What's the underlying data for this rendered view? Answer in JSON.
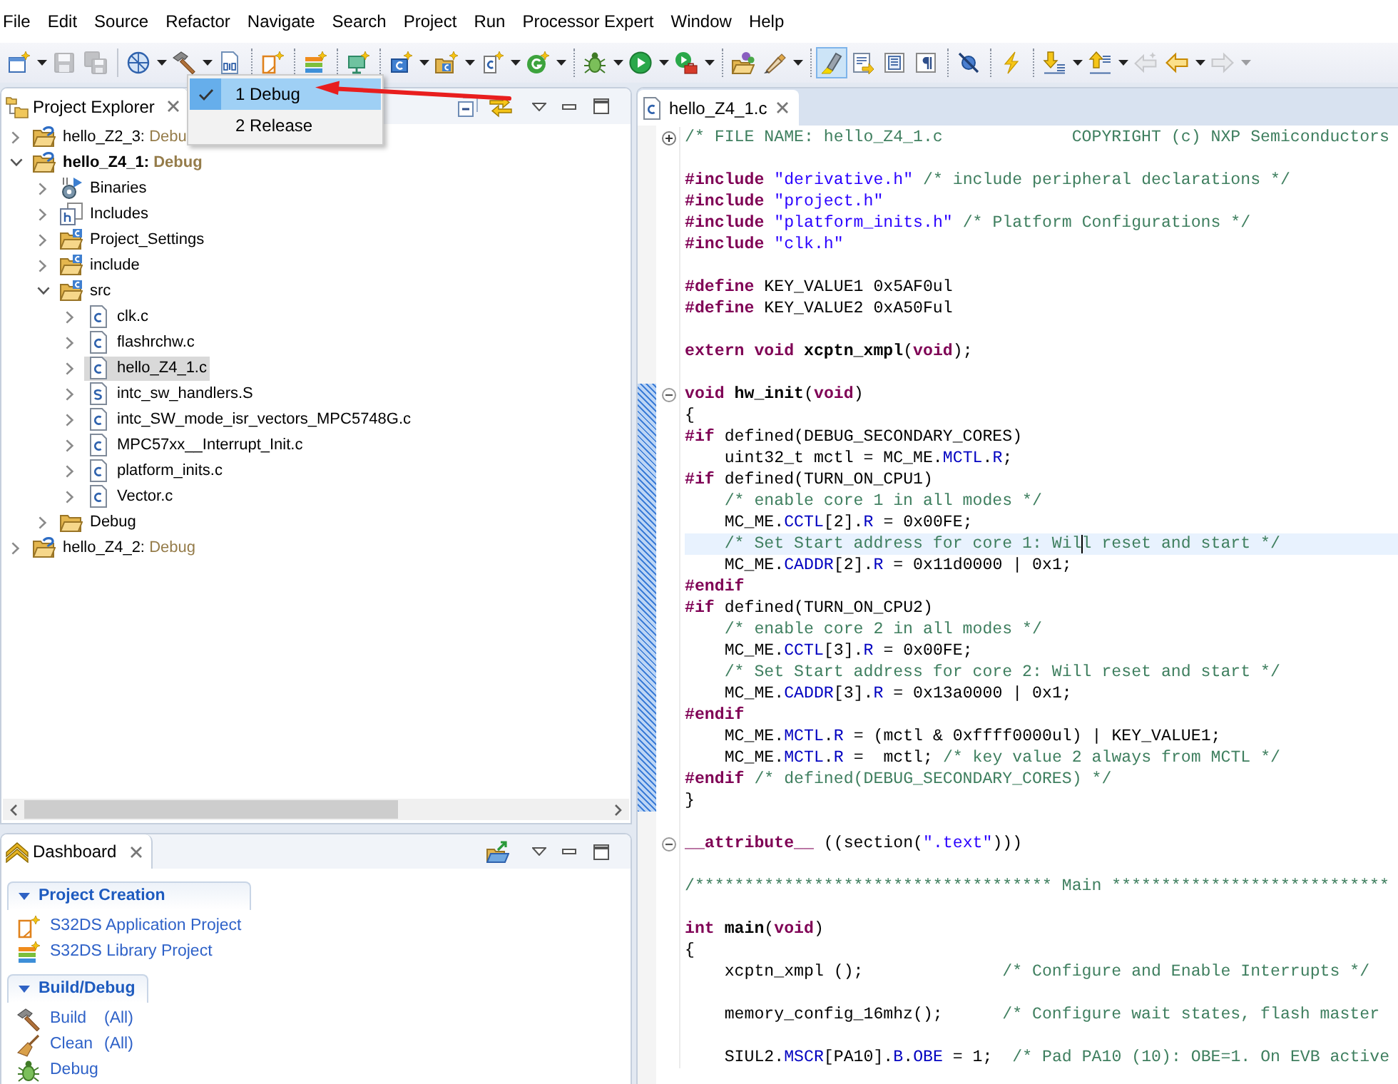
{
  "menu_bar": {
    "items": [
      "File",
      "Edit",
      "Source",
      "Refactor",
      "Navigate",
      "Search",
      "Project",
      "Run",
      "Processor Expert",
      "Window",
      "Help"
    ]
  },
  "toolbar": {
    "buttons": [
      {
        "disabled": false,
        "on": false
      },
      {
        "disabled": true,
        "on": false
      },
      {
        "disabled": true,
        "on": false
      },
      {
        "disabled": false,
        "on": false
      },
      {
        "disabled": false,
        "on": false
      },
      {
        "disabled": false,
        "on": false
      },
      {
        "disabled": false,
        "on": false
      },
      {
        "disabled": false,
        "on": false
      },
      {
        "disabled": false,
        "on": false
      },
      {
        "disabled": false,
        "on": false
      },
      {
        "disabled": false,
        "on": false
      },
      {
        "disabled": false,
        "on": false
      },
      {
        "disabled": false,
        "on": false
      },
      {
        "disabled": false,
        "on": false
      },
      {
        "disabled": false,
        "on": false
      },
      {
        "disabled": false,
        "on": false
      },
      {
        "disabled": false,
        "on": false
      },
      {
        "disabled": false,
        "on": false
      },
      {
        "disabled": false,
        "on": true
      },
      {
        "disabled": false,
        "on": false
      },
      {
        "disabled": false,
        "on": false
      },
      {
        "disabled": false,
        "on": false
      },
      {
        "disabled": false,
        "on": false
      },
      {
        "disabled": false,
        "on": false
      },
      {
        "disabled": false,
        "on": false
      },
      {
        "disabled": false,
        "on": false
      },
      {
        "disabled": true,
        "on": false
      },
      {
        "disabled": false,
        "on": false
      },
      {
        "disabled": true,
        "on": false
      }
    ]
  },
  "build_menu": {
    "items": [
      {
        "label": "1 Debug",
        "checked": true,
        "selected": true
      },
      {
        "label": "2 Release",
        "checked": false,
        "selected": false
      }
    ]
  },
  "project_explorer": {
    "title": "Project Explorer",
    "tree": [
      {
        "label": "hello_Z2_3:",
        "config": "Debu",
        "kind": "project",
        "active": false,
        "expanded": false,
        "selected": false
      },
      {
        "label": "hello_Z4_1:",
        "config": "Debug",
        "kind": "project",
        "active": true,
        "expanded": true,
        "selected": false,
        "children": [
          {
            "label": "Binaries",
            "kind": "binaries",
            "expanded": false,
            "selected": false
          },
          {
            "label": "Includes",
            "kind": "includes",
            "expanded": false,
            "selected": false
          },
          {
            "label": "Project_Settings",
            "kind": "source_folder",
            "expanded": false,
            "selected": false
          },
          {
            "label": "include",
            "kind": "source_folder",
            "expanded": false,
            "selected": false
          },
          {
            "label": "src",
            "kind": "source_folder",
            "expanded": true,
            "selected": false,
            "children": [
              {
                "label": "clk.c",
                "kind": "c_file",
                "expanded": false,
                "selected": false
              },
              {
                "label": "flashrchw.c",
                "kind": "c_file",
                "expanded": false,
                "selected": false
              },
              {
                "label": "hello_Z4_1.c",
                "kind": "c_file",
                "expanded": false,
                "selected": true
              },
              {
                "label": "intc_sw_handlers.S",
                "kind": "asm_file",
                "expanded": false,
                "selected": false
              },
              {
                "label": "intc_SW_mode_isr_vectors_MPC5748G.c",
                "kind": "c_file",
                "expanded": false,
                "selected": false
              },
              {
                "label": "MPC57xx__Interrupt_Init.c",
                "kind": "c_file",
                "expanded": false,
                "selected": false
              },
              {
                "label": "platform_inits.c",
                "kind": "c_file",
                "expanded": false,
                "selected": false
              },
              {
                "label": "Vector.c",
                "kind": "c_file",
                "expanded": false,
                "selected": false
              }
            ]
          },
          {
            "label": "Debug",
            "kind": "folder",
            "expanded": false,
            "selected": false
          }
        ]
      },
      {
        "label": "hello_Z4_2:",
        "config": "Debug",
        "kind": "project",
        "active": false,
        "expanded": false,
        "selected": false
      }
    ]
  },
  "dashboard": {
    "title": "Dashboard",
    "sections": [
      {
        "title": "Project Creation",
        "expanded": true,
        "links": [
          {
            "label": "S32DS Application Project"
          },
          {
            "label": "S32DS Library Project"
          }
        ]
      },
      {
        "title": "Build/Debug",
        "expanded": true,
        "links": [
          {
            "label": "Build",
            "scope": "(All)"
          },
          {
            "label": "Clean",
            "scope": "(All)"
          },
          {
            "label": "Debug"
          }
        ]
      }
    ]
  },
  "editor": {
    "tabs": [
      {
        "label": "hello_Z4_1.c",
        "selected": true
      }
    ],
    "lines": [
      {
        "kind": "code",
        "expanded": false,
        "in_range": false,
        "current": false,
        "tokens": [
          {
            "kind": "comment",
            "text": "/* FILE NAME: hello_Z4_1.c             COPYRIGHT (c) NXP Semiconductors"
          }
        ]
      },
      {
        "kind": "blank",
        "in_range": false,
        "current": false
      },
      {
        "kind": "code",
        "in_range": false,
        "current": false,
        "tokens": [
          {
            "kind": "keyword",
            "text": "#include"
          },
          {
            "kind": "string",
            "text": " \"derivative.h\""
          },
          {
            "kind": "comment",
            "text": " /* include peripheral declarations */"
          }
        ]
      },
      {
        "kind": "code",
        "in_range": false,
        "current": false,
        "tokens": [
          {
            "kind": "keyword",
            "text": "#include"
          },
          {
            "kind": "string",
            "text": " \"project.h\""
          }
        ]
      },
      {
        "kind": "code",
        "in_range": false,
        "current": false,
        "tokens": [
          {
            "kind": "keyword",
            "text": "#include"
          },
          {
            "kind": "string",
            "text": " \"platform_inits.h\""
          },
          {
            "kind": "comment",
            "text": " /* Platform Configurations */"
          }
        ]
      },
      {
        "kind": "code",
        "in_range": false,
        "current": false,
        "tokens": [
          {
            "kind": "keyword",
            "text": "#include"
          },
          {
            "kind": "string",
            "text": " \"clk.h\""
          }
        ]
      },
      {
        "kind": "blank",
        "in_range": false,
        "current": false
      },
      {
        "kind": "code",
        "in_range": false,
        "current": false,
        "tokens": [
          {
            "kind": "keyword",
            "text": "#define"
          },
          {
            "kind": "plain",
            "text": " KEY_VALUE1 0x5AF0ul"
          }
        ]
      },
      {
        "kind": "code",
        "in_range": false,
        "current": false,
        "tokens": [
          {
            "kind": "keyword",
            "text": "#define"
          },
          {
            "kind": "plain",
            "text": " KEY_VALUE2 0xA50Ful"
          }
        ]
      },
      {
        "kind": "blank",
        "in_range": false,
        "current": false
      },
      {
        "kind": "code",
        "in_range": false,
        "current": false,
        "tokens": [
          {
            "kind": "keyword",
            "text": "extern"
          },
          {
            "kind": "keyword",
            "text": " void"
          },
          {
            "kind": "function",
            "text": " xcptn_xmpl"
          },
          {
            "kind": "plain",
            "text": "("
          },
          {
            "kind": "keyword",
            "text": "void"
          },
          {
            "kind": "plain",
            "text": ");"
          }
        ]
      },
      {
        "kind": "blank",
        "in_range": false,
        "current": false
      },
      {
        "kind": "code",
        "expanded": true,
        "in_range": true,
        "current": false,
        "tokens": [
          {
            "kind": "keyword",
            "text": "void"
          },
          {
            "kind": "function",
            "text": " hw_init"
          },
          {
            "kind": "plain",
            "text": "("
          },
          {
            "kind": "keyword",
            "text": "void"
          },
          {
            "kind": "plain",
            "text": ")"
          }
        ]
      },
      {
        "kind": "code",
        "in_range": true,
        "current": false,
        "tokens": [
          {
            "kind": "plain",
            "text": "{"
          }
        ]
      },
      {
        "kind": "code",
        "in_range": true,
        "current": false,
        "tokens": [
          {
            "kind": "keyword",
            "text": "#if"
          },
          {
            "kind": "plain",
            "text": " defined(DEBUG_SECONDARY_CORES)"
          }
        ]
      },
      {
        "kind": "code",
        "in_range": true,
        "current": false,
        "tokens": [
          {
            "kind": "plain",
            "text": "    uint32_t mctl = MC_ME."
          },
          {
            "kind": "field",
            "text": "MCTL"
          },
          {
            "kind": "plain",
            "text": "."
          },
          {
            "kind": "field",
            "text": "R"
          },
          {
            "kind": "plain",
            "text": ";"
          }
        ]
      },
      {
        "kind": "code",
        "in_range": true,
        "current": false,
        "tokens": [
          {
            "kind": "keyword",
            "text": "#if"
          },
          {
            "kind": "plain",
            "text": " defined(TURN_ON_CPU1)"
          }
        ]
      },
      {
        "kind": "code",
        "in_range": true,
        "current": false,
        "tokens": [
          {
            "kind": "comment",
            "text": "    /* enable core 1 in all modes */"
          }
        ]
      },
      {
        "kind": "code",
        "in_range": true,
        "current": false,
        "tokens": [
          {
            "kind": "plain",
            "text": "    MC_ME."
          },
          {
            "kind": "field",
            "text": "CCTL"
          },
          {
            "kind": "plain",
            "text": "[2]."
          },
          {
            "kind": "field",
            "text": "R"
          },
          {
            "kind": "plain",
            "text": " = 0x00FE;"
          }
        ]
      },
      {
        "kind": "code",
        "in_range": true,
        "current": true,
        "tokens": [
          {
            "kind": "comment",
            "text": "    /* Set Start address for core 1: Wil"
          },
          {
            "kind": "cursor"
          },
          {
            "kind": "comment",
            "text": "l reset and start */"
          }
        ]
      },
      {
        "kind": "code",
        "in_range": true,
        "current": false,
        "tokens": [
          {
            "kind": "plain",
            "text": "    MC_ME."
          },
          {
            "kind": "field",
            "text": "CADDR"
          },
          {
            "kind": "plain",
            "text": "[2]."
          },
          {
            "kind": "field",
            "text": "R"
          },
          {
            "kind": "plain",
            "text": " = 0x11d0000 | 0x1;"
          }
        ]
      },
      {
        "kind": "code",
        "in_range": true,
        "current": false,
        "tokens": [
          {
            "kind": "keyword",
            "text": "#endif"
          }
        ]
      },
      {
        "kind": "code",
        "in_range": true,
        "current": false,
        "tokens": [
          {
            "kind": "keyword",
            "text": "#if"
          },
          {
            "kind": "plain",
            "text": " defined(TURN_ON_CPU2)"
          }
        ]
      },
      {
        "kind": "code",
        "in_range": true,
        "current": false,
        "tokens": [
          {
            "kind": "comment",
            "text": "    /* enable core 2 in all modes */"
          }
        ]
      },
      {
        "kind": "code",
        "in_range": true,
        "current": false,
        "tokens": [
          {
            "kind": "plain",
            "text": "    MC_ME."
          },
          {
            "kind": "field",
            "text": "CCTL"
          },
          {
            "kind": "plain",
            "text": "[3]."
          },
          {
            "kind": "field",
            "text": "R"
          },
          {
            "kind": "plain",
            "text": " = 0x00FE;"
          }
        ]
      },
      {
        "kind": "code",
        "in_range": true,
        "current": false,
        "tokens": [
          {
            "kind": "comment",
            "text": "    /* Set Start address for core 2: Will reset and start */"
          }
        ]
      },
      {
        "kind": "code",
        "in_range": true,
        "current": false,
        "tokens": [
          {
            "kind": "plain",
            "text": "    MC_ME."
          },
          {
            "kind": "field",
            "text": "CADDR"
          },
          {
            "kind": "plain",
            "text": "[3]."
          },
          {
            "kind": "field",
            "text": "R"
          },
          {
            "kind": "plain",
            "text": " = 0x13a0000 | 0x1;"
          }
        ]
      },
      {
        "kind": "code",
        "in_range": true,
        "current": false,
        "tokens": [
          {
            "kind": "keyword",
            "text": "#endif"
          }
        ]
      },
      {
        "kind": "code",
        "in_range": true,
        "current": false,
        "tokens": [
          {
            "kind": "plain",
            "text": "    MC_ME."
          },
          {
            "kind": "field",
            "text": "MCTL"
          },
          {
            "kind": "plain",
            "text": "."
          },
          {
            "kind": "field",
            "text": "R"
          },
          {
            "kind": "plain",
            "text": " = (mctl & 0xffff0000ul) | KEY_VALUE1;"
          }
        ]
      },
      {
        "kind": "code",
        "in_range": true,
        "current": false,
        "tokens": [
          {
            "kind": "plain",
            "text": "    MC_ME."
          },
          {
            "kind": "field",
            "text": "MCTL"
          },
          {
            "kind": "plain",
            "text": "."
          },
          {
            "kind": "field",
            "text": "R"
          },
          {
            "kind": "plain",
            "text": " =  mctl; "
          },
          {
            "kind": "comment",
            "text": "/* key value 2 always from MCTL */"
          }
        ]
      },
      {
        "kind": "code",
        "in_range": true,
        "current": false,
        "tokens": [
          {
            "kind": "keyword",
            "text": "#endif"
          },
          {
            "kind": "comment",
            "text": " /* defined(DEBUG_SECONDARY_CORES) */"
          }
        ]
      },
      {
        "kind": "code",
        "in_range": true,
        "current": false,
        "tokens": [
          {
            "kind": "plain",
            "text": "}"
          }
        ]
      },
      {
        "kind": "blank",
        "in_range": false,
        "current": false
      },
      {
        "kind": "code",
        "expanded": true,
        "in_range": false,
        "current": false,
        "tokens": [
          {
            "kind": "keyword",
            "text": "__attribute__"
          },
          {
            "kind": "plain",
            "text": " ((section("
          },
          {
            "kind": "string",
            "text": "\".text\""
          },
          {
            "kind": "plain",
            "text": ")))"
          }
        ]
      },
      {
        "kind": "blank",
        "in_range": false,
        "current": false
      },
      {
        "kind": "code",
        "in_range": false,
        "current": false,
        "tokens": [
          {
            "kind": "comment",
            "text": "/************************************ Main ****************************"
          }
        ]
      },
      {
        "kind": "blank",
        "in_range": false,
        "current": false
      },
      {
        "kind": "code",
        "in_range": false,
        "current": false,
        "tokens": [
          {
            "kind": "keyword",
            "text": "int"
          },
          {
            "kind": "function",
            "text": " main"
          },
          {
            "kind": "plain",
            "text": "("
          },
          {
            "kind": "keyword",
            "text": "void"
          },
          {
            "kind": "plain",
            "text": ")"
          }
        ]
      },
      {
        "kind": "code",
        "in_range": false,
        "current": false,
        "tokens": [
          {
            "kind": "plain",
            "text": "{"
          }
        ]
      },
      {
        "kind": "code",
        "in_range": false,
        "current": false,
        "tokens": [
          {
            "kind": "plain",
            "text": "    xcptn_xmpl ();              "
          },
          {
            "kind": "comment",
            "text": "/* Configure and Enable Interrupts */"
          }
        ]
      },
      {
        "kind": "blank",
        "in_range": false,
        "current": false
      },
      {
        "kind": "code",
        "in_range": false,
        "current": false,
        "tokens": [
          {
            "kind": "plain",
            "text": "    memory_config_16mhz();      "
          },
          {
            "kind": "comment",
            "text": "/* Configure wait states, flash master"
          }
        ]
      },
      {
        "kind": "blank",
        "in_range": false,
        "current": false
      },
      {
        "kind": "code",
        "in_range": false,
        "current": false,
        "tokens": [
          {
            "kind": "plain",
            "text": "    SIUL2."
          },
          {
            "kind": "field",
            "text": "MSCR"
          },
          {
            "kind": "plain",
            "text": "[PA10]."
          },
          {
            "kind": "field",
            "text": "B"
          },
          {
            "kind": "plain",
            "text": "."
          },
          {
            "kind": "field",
            "text": "OBE"
          },
          {
            "kind": "plain",
            "text": " = 1;  "
          },
          {
            "kind": "comment",
            "text": "/* Pad PA10 (10): OBE=1. On EVB active"
          }
        ]
      }
    ]
  }
}
